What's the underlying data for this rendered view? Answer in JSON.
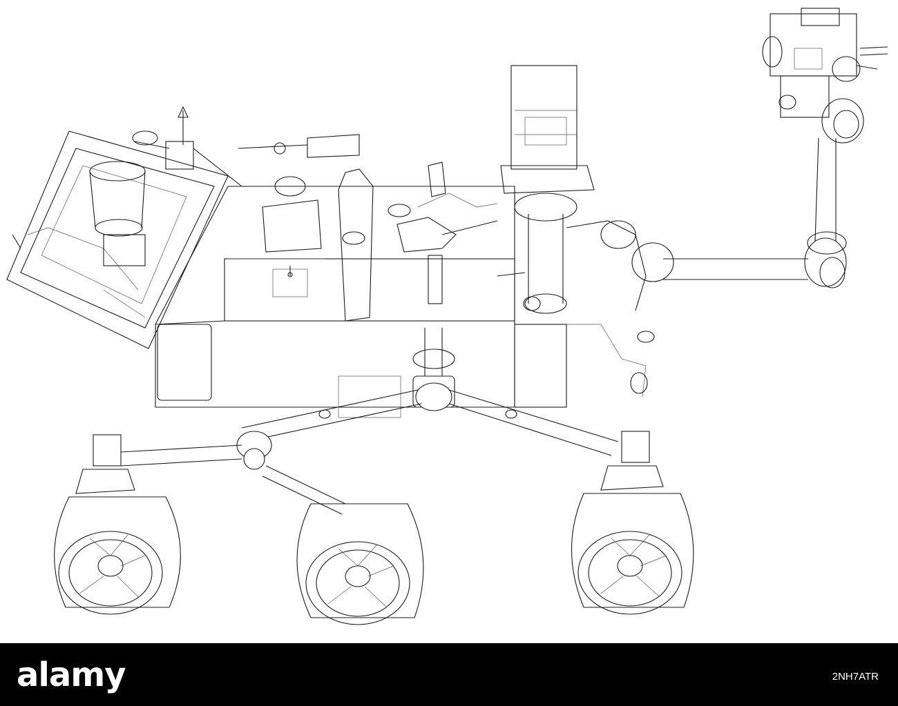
{
  "footer": {
    "brand": "alamy",
    "image_id": "2NH7ATR",
    "background_color": "#000000",
    "text_color": "#ffffff"
  },
  "illustration": {
    "style": "wireframe line drawing",
    "line_color": "#1a1a1a",
    "background_color": "#ffffff"
  }
}
